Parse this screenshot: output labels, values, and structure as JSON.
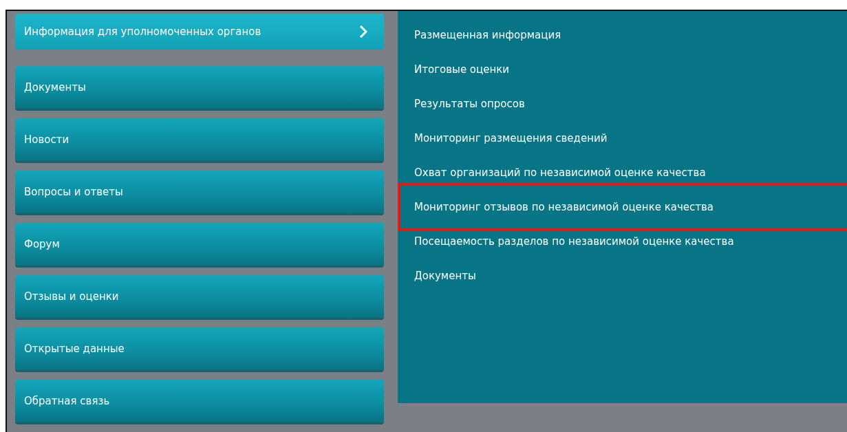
{
  "menu": [
    {
      "label": "Информация для уполномоченных органов",
      "selected": true,
      "has_submenu": true
    },
    {
      "label": "Документы",
      "selected": false,
      "has_submenu": false
    },
    {
      "label": "Новости",
      "selected": false,
      "has_submenu": false
    },
    {
      "label": "Вопросы и ответы",
      "selected": false,
      "has_submenu": false
    },
    {
      "label": "Форум",
      "selected": false,
      "has_submenu": false
    },
    {
      "label": "Отзывы и оценки",
      "selected": false,
      "has_submenu": false
    },
    {
      "label": "Открытые данные",
      "selected": false,
      "has_submenu": false
    },
    {
      "label": "Обратная связь",
      "selected": false,
      "has_submenu": false
    }
  ],
  "submenu": [
    {
      "label": "Размещенная информация",
      "highlighted": false
    },
    {
      "label": "Итоговые оценки",
      "highlighted": false
    },
    {
      "label": "Результаты опросов",
      "highlighted": false
    },
    {
      "label": "Мониторинг размещения сведений",
      "highlighted": false
    },
    {
      "label": "Охват организаций по независимой оценке качества",
      "highlighted": false
    },
    {
      "label": "Мониторинг отзывов по независимой оценке качества",
      "highlighted": true
    },
    {
      "label": "Посещаемость разделов по независимой оценке качества",
      "highlighted": false
    },
    {
      "label": "Документы",
      "highlighted": false
    }
  ]
}
